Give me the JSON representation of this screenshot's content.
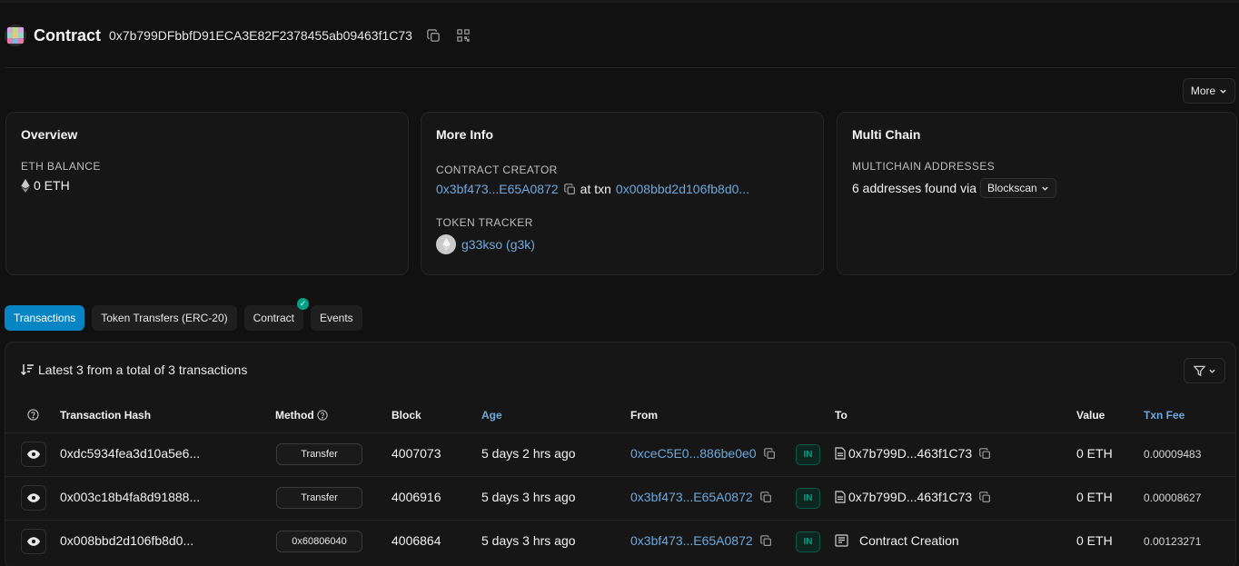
{
  "header": {
    "title": "Contract",
    "address": "0x7b799DFbbfD91ECA3E82F2378455ab09463f1C73"
  },
  "more_button": {
    "label": "More"
  },
  "overview": {
    "title": "Overview",
    "balance_label": "ETH BALANCE",
    "balance_value": "0 ETH"
  },
  "more_info": {
    "title": "More Info",
    "creator_label": "CONTRACT CREATOR",
    "creator_address": "0x3bf473...E65A0872",
    "at_txn": "at txn",
    "creator_txn": "0x008bbd2d106fb8d0...",
    "token_label": "TOKEN TRACKER",
    "token_name": "g33kso (g3k)"
  },
  "multi_chain": {
    "title": "Multi Chain",
    "label": "MULTICHAIN ADDRESSES",
    "found_text": "6 addresses found via",
    "provider": "Blockscan"
  },
  "tabs": [
    {
      "label": "Transactions",
      "active": true
    },
    {
      "label": "Token Transfers (ERC-20)"
    },
    {
      "label": "Contract",
      "verified": true
    },
    {
      "label": "Events"
    }
  ],
  "table": {
    "summary": "Latest 3 from a total of 3 transactions",
    "columns": [
      "Transaction Hash",
      "Method",
      "Block",
      "Age",
      "From",
      "To",
      "Value",
      "Txn Fee"
    ],
    "rows": [
      {
        "hash": "0xdc5934fea3d10a5e6...",
        "method": "Transfer",
        "block": "4007073",
        "age": "5 days 2 hrs ago",
        "from": "0xceC5E0...886be0e0",
        "direction": "IN",
        "to": "0x7b799D...463f1C73",
        "value": "0 ETH",
        "fee": "0.00009483"
      },
      {
        "hash": "0x003c18b4fa8d91888...",
        "method": "Transfer",
        "block": "4006916",
        "age": "5 days 3 hrs ago",
        "from": "0x3bf473...E65A0872",
        "direction": "IN",
        "to": "0x7b799D...463f1C73",
        "value": "0 ETH",
        "fee": "0.00008627"
      },
      {
        "hash": "0x008bbd2d106fb8d0...",
        "method": "0x60806040",
        "block": "4006864",
        "age": "5 days 3 hrs ago",
        "from": "0x3bf473...E65A0872",
        "direction": "IN",
        "to": "Contract Creation",
        "value": "0 ETH",
        "fee": "0.00123271"
      }
    ]
  },
  "colors": {
    "accent": "#0784c3",
    "link": "#6ea8dc",
    "success": "#00a186",
    "background": "#111111",
    "card": "#161616"
  },
  "icons": [
    "copy-icon",
    "qr-code-icon",
    "ethereum-icon",
    "chevron-down-icon",
    "sort-icon",
    "filter-icon",
    "question-circle-icon",
    "eye-icon",
    "document-icon",
    "contract-creation-icon",
    "check-icon"
  ]
}
